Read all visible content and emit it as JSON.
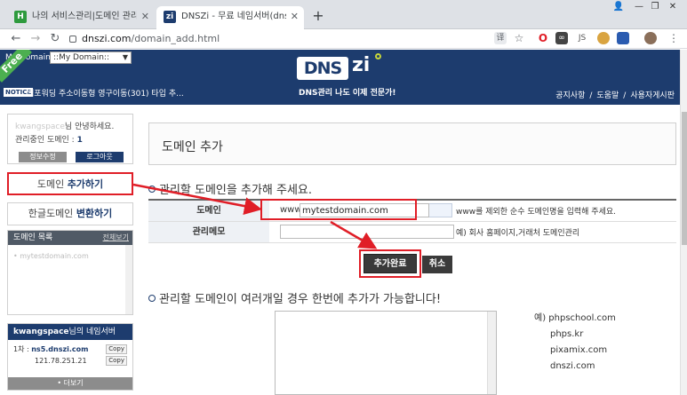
{
  "browser": {
    "tabs": [
      {
        "title": "나의 서비스관리|도메인 관리|보유",
        "favicon_text": "H",
        "favicon_color": "#2e9a3e",
        "active": false
      },
      {
        "title": "DNSZi - 무료 네임서버(dns) 관리",
        "favicon_text": "zi",
        "favicon_color": "#1d3c6e",
        "active": true
      }
    ],
    "url_domain": "dnszi.com",
    "url_path": "/domain_add.html",
    "extensions": [
      "translate-icon",
      "star-icon",
      "opera-icon",
      "mask-icon",
      "js-icon",
      "cookie-icon",
      "flag-icon",
      "avatar-icon",
      "menu-icon"
    ]
  },
  "site": {
    "free_ribbon": "Free",
    "mydomain_label": "My Domain :",
    "mydomain_select": "::My Domain::",
    "logo_dns": "DNS",
    "logo_zi": "zi",
    "tagline": "DNS관리 나도 이제 전문가!",
    "notice_badge": "NOTICE",
    "notice_text": "웹포워딩 주소이동형 영구이동(301) 타입 추...",
    "topnav": [
      "공지사항",
      "도움말",
      "사용자게시판"
    ]
  },
  "sidebar": {
    "greeting_blur": "kwangspace",
    "greeting": "님 안녕하세요.",
    "count_label": "관리중인 도메인 : ",
    "count_value": "1",
    "btn_info": "정보수정",
    "btn_logout": "로그아웃",
    "add_prefix": "도메인 ",
    "add_bold": "추가하기",
    "convert_prefix": "한글도메인 ",
    "convert_bold": "변환하기",
    "domlist_title": "도메인 목록",
    "domlist_more": "전체보기",
    "domlist_item": "• mytestdomain.com",
    "ns_user": "kwangspace",
    "ns_title_suffix": "님의 네임서버",
    "ns_label": "1차 : ",
    "ns_host": "ns5.dnszi.com",
    "ns_ip": "121.78.251.21",
    "copy": "Copy",
    "more": "• 더보기"
  },
  "main": {
    "title": "도메인 추가",
    "section1": "관리할 도메인을 추가해 주세요.",
    "domain_label": "도메인",
    "domain_prefix": "www.",
    "domain_value": "mytestdomain.com",
    "domain_hint": "www를 제외한 순수 도메인명을 입력해 주세요.",
    "memo_label": "관리메모",
    "memo_value": "",
    "memo_hint": "예) 회사 홈페이지,거래처 도메인관리",
    "submit": "추가완료",
    "cancel": "취소",
    "section2": "관리할 도메인이 여러개일 경우 한번에 추가가 가능합니다!",
    "examples_prefix": "예) ",
    "examples": [
      "phpschool.com",
      "phps.kr",
      "pixamix.com",
      "dnszi.com"
    ]
  },
  "colors": {
    "header_navy": "#1d3c6e",
    "annotation_red": "#e01e27",
    "free_green": "#4caf50"
  }
}
